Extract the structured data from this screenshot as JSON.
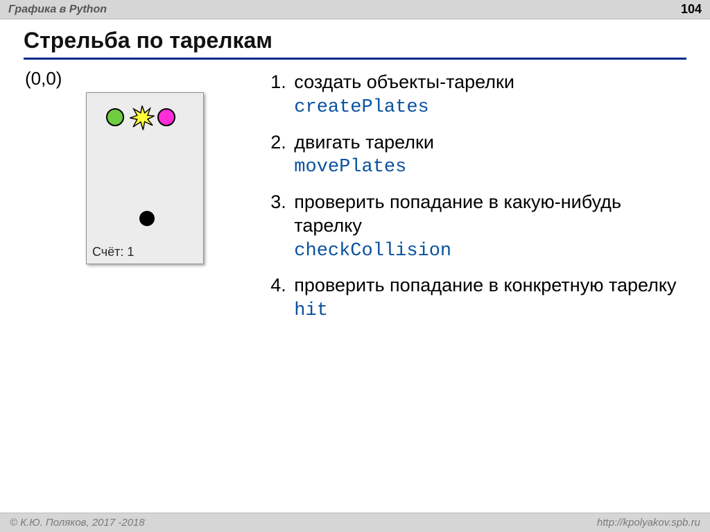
{
  "header": {
    "section_title": "Графика в Python",
    "page_number": "104"
  },
  "slide": {
    "title": "Стрельба по тарелкам",
    "origin_label": "(0,0)",
    "score_label": "Счёт: 1"
  },
  "steps": [
    {
      "text": "создать объекты-тарелки",
      "code": "createPlates"
    },
    {
      "text": "двигать тарелки",
      "code": "movePlates"
    },
    {
      "text": "проверить попадание в какую-нибудь тарелку",
      "code": "checkCollision"
    },
    {
      "text": "проверить попадание в конкретную тарелку",
      "code": "hit"
    }
  ],
  "footer": {
    "copyright": "© К.Ю. Поляков, 2017 -2018",
    "url": "http://kpolyakov.spb.ru"
  }
}
